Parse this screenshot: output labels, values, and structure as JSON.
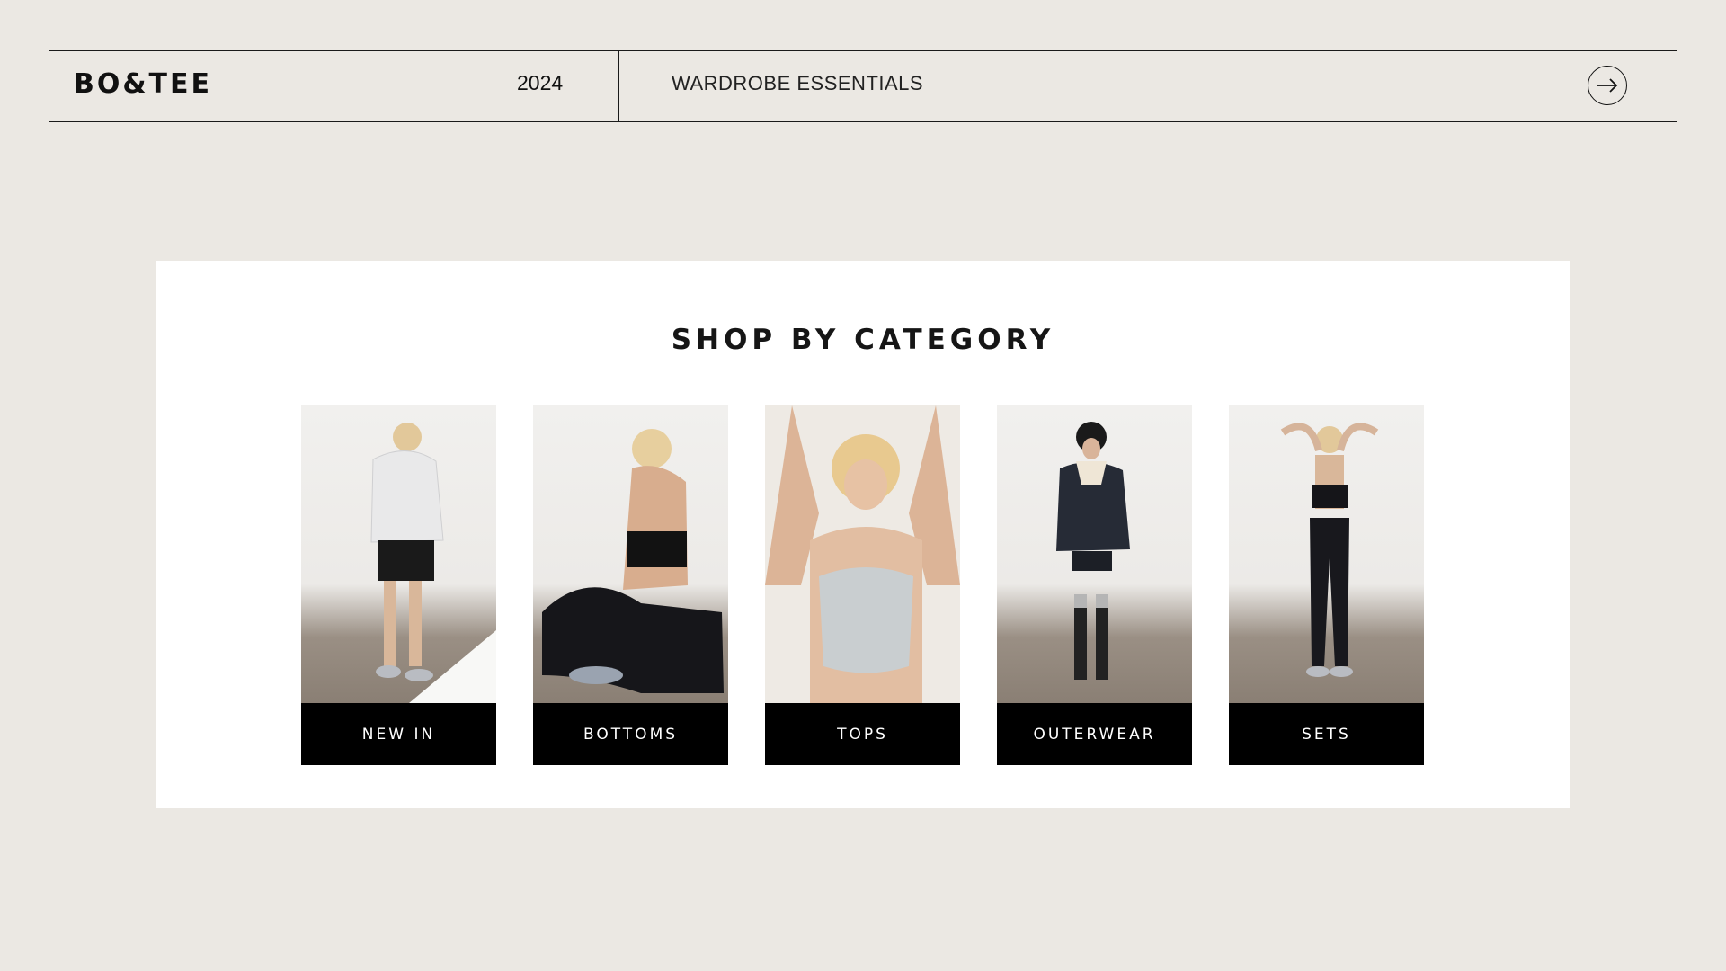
{
  "header": {
    "brand": "BO&TEE",
    "year": "2024",
    "section_title": "WARDROBE ESSENTIALS",
    "next_icon": "arrow-right-icon"
  },
  "panel": {
    "title": "SHOP BY CATEGORY",
    "categories": [
      {
        "label": "NEW IN",
        "image": "model-white-hoodie-photo"
      },
      {
        "label": "BOTTOMS",
        "image": "model-seated-leggings-photo"
      },
      {
        "label": "TOPS",
        "image": "model-grey-sports-bra-photo"
      },
      {
        "label": "OUTERWEAR",
        "image": "model-puffer-jacket-photo"
      },
      {
        "label": "SETS",
        "image": "model-black-set-photo"
      }
    ]
  },
  "colors": {
    "background": "#ebe8e3",
    "panel": "#ffffff",
    "label_bg": "#000000",
    "line": "#1a1a1a"
  }
}
